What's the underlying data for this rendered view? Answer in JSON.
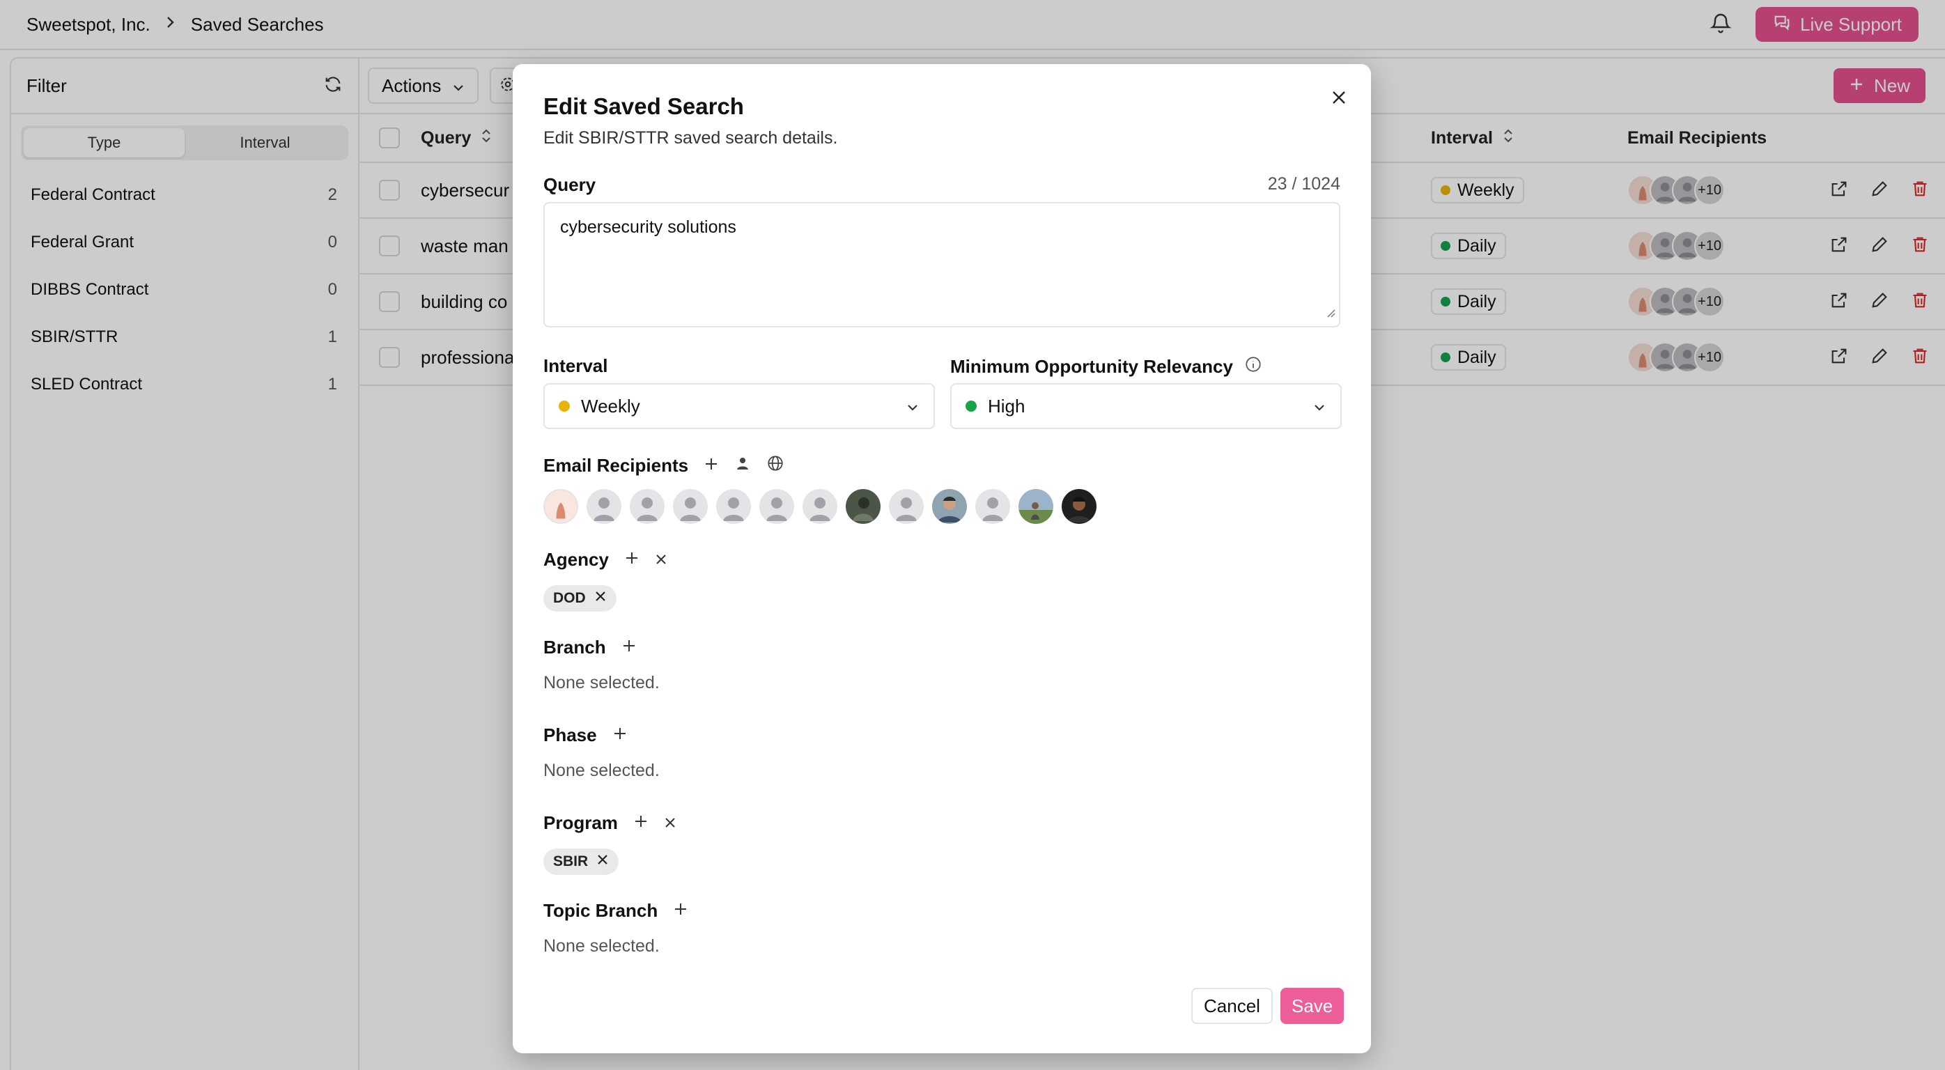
{
  "topbar": {
    "org": "Sweetspot, Inc.",
    "page": "Saved Searches",
    "live_support": "Live Support"
  },
  "sidebar": {
    "title": "Filter",
    "tabs": [
      "Type",
      "Interval"
    ],
    "items": [
      {
        "label": "Federal Contract",
        "count": "2"
      },
      {
        "label": "Federal Grant",
        "count": "0"
      },
      {
        "label": "DIBBS Contract",
        "count": "0"
      },
      {
        "label": "SBIR/STTR",
        "count": "1"
      },
      {
        "label": "SLED Contract",
        "count": "1"
      }
    ]
  },
  "toolbar": {
    "actions": "Actions",
    "new": "New"
  },
  "table": {
    "columns": {
      "query": "Query",
      "interval": "Interval",
      "recipients": "Email Recipients"
    },
    "rows": [
      {
        "query": "cybersecur",
        "interval": "Weekly",
        "more": "+10"
      },
      {
        "query": "waste man",
        "interval": "Daily",
        "more": "+10"
      },
      {
        "query": "building co",
        "interval": "Daily",
        "more": "+10"
      },
      {
        "query": "professiona",
        "interval": "Daily",
        "more": "+10"
      }
    ]
  },
  "colors": {
    "accent": "#e4508f",
    "weekly": "#eab308",
    "daily": "#16a34a",
    "danger": "#dc2626"
  },
  "modal": {
    "title": "Edit Saved Search",
    "description": "Edit SBIR/STTR saved search details.",
    "query_label": "Query",
    "query_counter": "23 / 1024",
    "query_value": "cybersecurity solutions",
    "interval_label": "Interval",
    "interval_value": "Weekly",
    "relevancy_label": "Minimum Opportunity Relevancy",
    "relevancy_value": "High",
    "recipients_label": "Email Recipients",
    "agency_label": "Agency",
    "agency_chip": "DOD",
    "branch_label": "Branch",
    "branch_empty": "None selected.",
    "phase_label": "Phase",
    "phase_empty": "None selected.",
    "program_label": "Program",
    "program_chip": "SBIR",
    "topic_branch_label": "Topic Branch",
    "topic_branch_empty": "None selected.",
    "cancel": "Cancel",
    "save": "Save"
  }
}
